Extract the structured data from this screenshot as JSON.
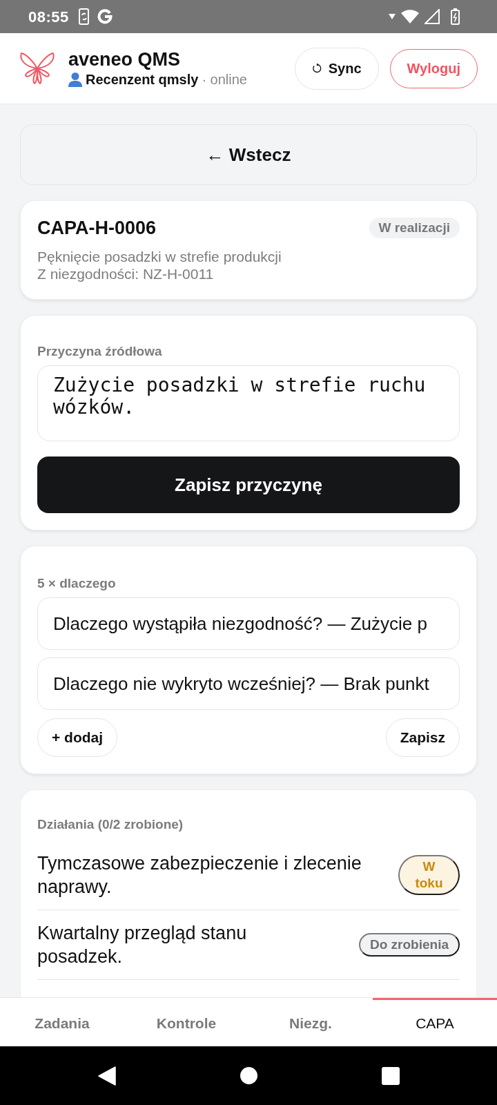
{
  "status_bar": {
    "time": "08:55"
  },
  "header": {
    "app_name": "aveneo QMS",
    "user": "Recenzent qmsly",
    "connection": "· online",
    "buttons": [
      {
        "kind": "sync",
        "label": "Sync"
      },
      {
        "kind": "logout",
        "label": "Wyloguj"
      }
    ]
  },
  "back_button": {
    "label": "← Wstecz"
  },
  "capa": {
    "id": "CAPA-H-0006",
    "status": "W realizacji",
    "title": "Pęknięcie posadzki w strefie produkcji",
    "source": "Z niezgodności: NZ-H-0011"
  },
  "root_cause": {
    "label": "Przyczyna źródłowa",
    "value": "Zużycie posadzki w strefie ruchu wózków.",
    "button": "Zapisz przyczynę"
  },
  "five_whys": {
    "label": "5 × dlaczego",
    "answers": [
      "Dlaczego wystąpiła niezgodność? — Zużycie p",
      "Dlaczego nie wykryto wcześniej? — Brak punkt"
    ],
    "add_button": "+ dodaj",
    "save_button": "Zapisz"
  },
  "actions": {
    "label": "Działania (0/2 zrobione)",
    "items": [
      {
        "text": "Tymczasowe zabezpieczenie i zlecenie naprawy.",
        "status": "W toku",
        "kind": "in_progress"
      },
      {
        "text": "Kwartalny przegląd stanu posadzek.",
        "status": "Do zrobienia",
        "kind": "todo"
      }
    ]
  },
  "bottom_nav": {
    "tabs": [
      {
        "label": "Zadania",
        "selected": false
      },
      {
        "label": "Kontrole",
        "selected": false
      },
      {
        "label": "Niezg.",
        "selected": false
      },
      {
        "label": "CAPA",
        "selected": true
      }
    ]
  }
}
